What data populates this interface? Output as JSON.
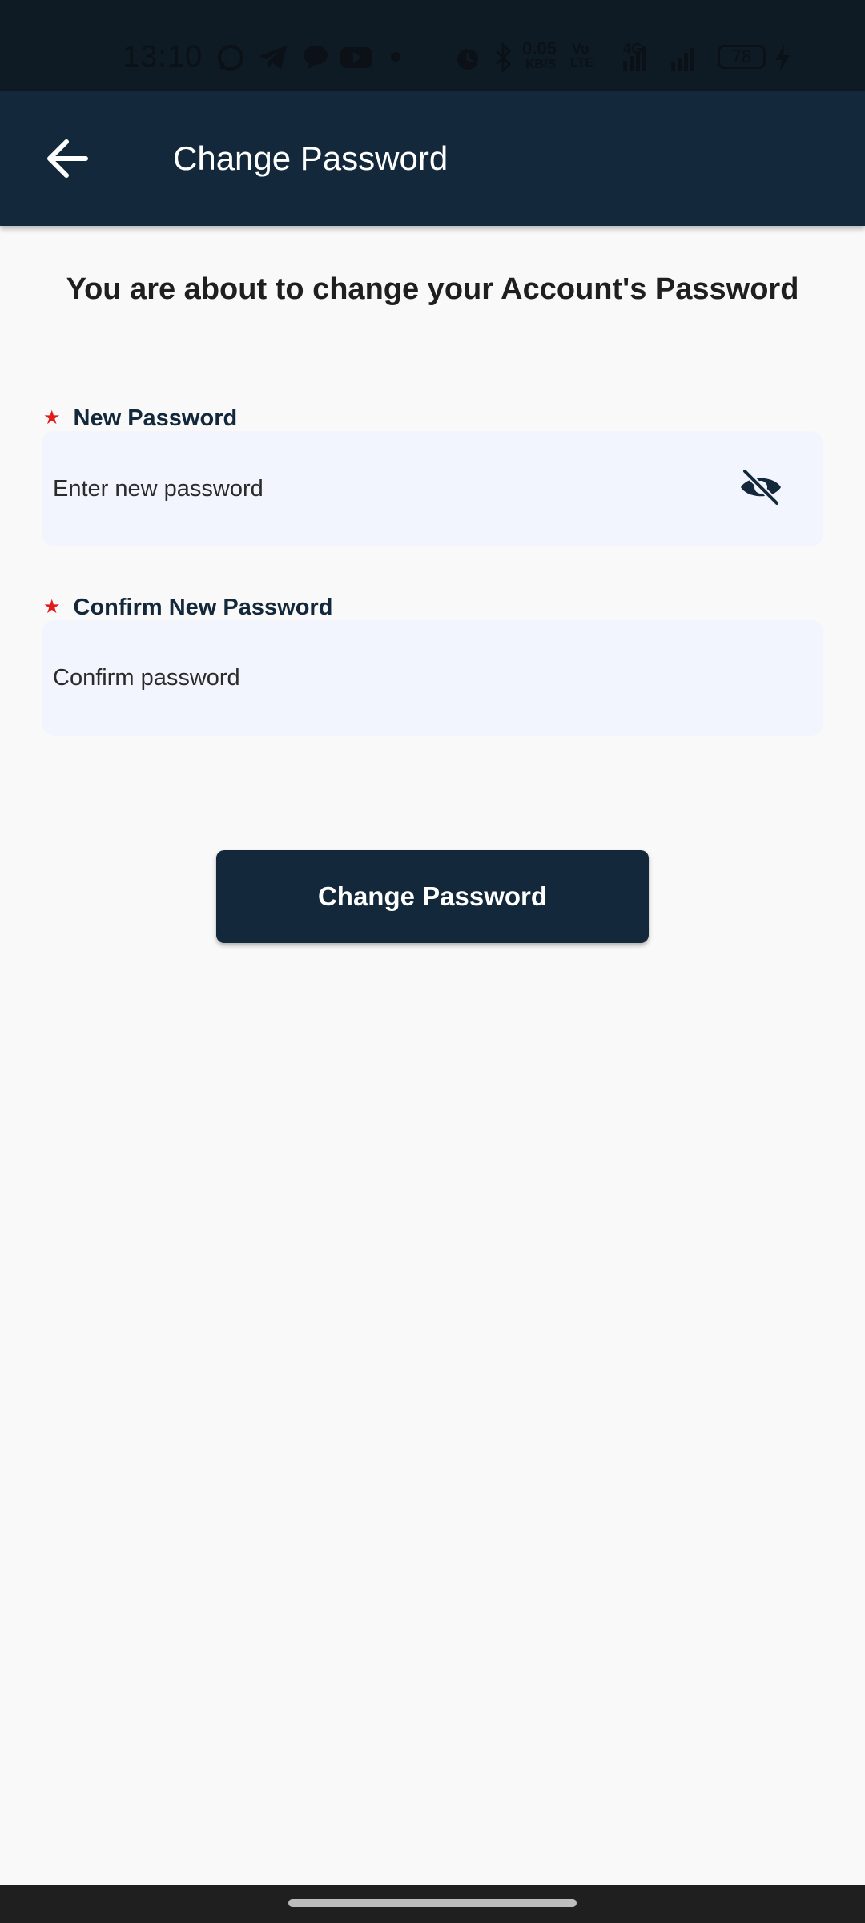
{
  "status_bar": {
    "time": "13:10",
    "net_speed_value": "0.05",
    "net_speed_unit": "KB/S",
    "volte_top": "Vo",
    "volte_bottom": "LTE",
    "network_type": "4G",
    "battery_level": "78",
    "icons": [
      "whatsapp-icon",
      "telegram-icon",
      "chat-bubble-icon",
      "youtube-icon",
      "notification-dot-icon",
      "alarm-icon",
      "bluetooth-icon",
      "signal-icon",
      "charging-icon"
    ]
  },
  "app_bar": {
    "title": "Change Password",
    "back_icon": "arrow-left-icon"
  },
  "main": {
    "intro_text": "You are about to change your Account's Password",
    "new_password": {
      "required_mark": "★",
      "label": "New Password",
      "placeholder": "Enter new password",
      "value": "",
      "toggle_icon": "eye-off-icon"
    },
    "confirm_password": {
      "required_mark": "★",
      "label": "Confirm New Password",
      "placeholder": "Confirm password",
      "value": ""
    },
    "submit_label": "Change Password"
  },
  "colors": {
    "primary": "#13293b",
    "required": "#e01b1b",
    "field_bg": "#f2f5fd",
    "page_bg": "#f9f9f9"
  }
}
